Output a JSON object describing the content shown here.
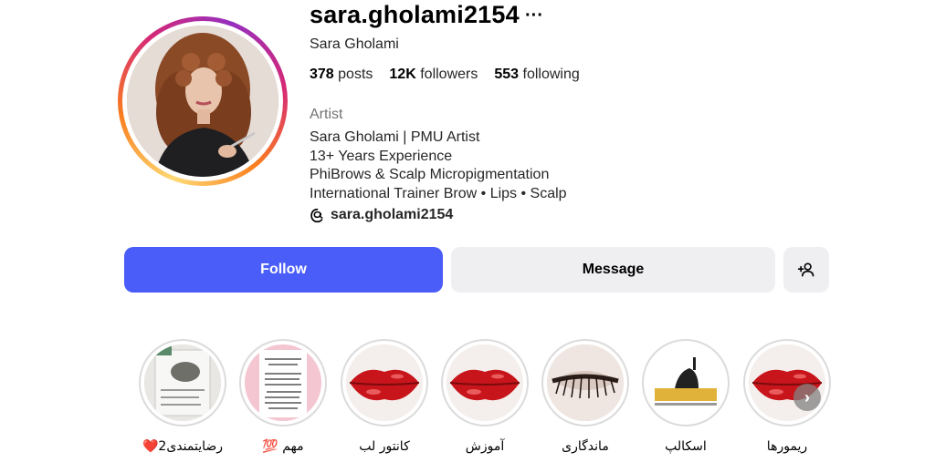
{
  "profile": {
    "username": "sara.gholami2154",
    "full_name": "Sara Gholami",
    "stats": {
      "posts_count": "378",
      "posts_label": "posts",
      "followers_count": "12K",
      "followers_label": "followers",
      "following_count": "553",
      "following_label": "following"
    },
    "category": "Artist",
    "bio_lines": [
      "Sara Gholami | PMU Artist",
      "13+ Years Experience",
      "PhiBrows & Scalp Micropigmentation",
      "International Trainer Brow • Lips • Scalp"
    ],
    "threads_handle": "sara.gholami2154"
  },
  "actions": {
    "follow_label": "Follow",
    "message_label": "Message",
    "add_user_icon": "add-user-icon",
    "more_icon": "more-horizontal-icon"
  },
  "colors": {
    "follow_button": "#4a5df9",
    "secondary_button": "#efeff2",
    "ring_gradient": [
      "#feda75",
      "#fa7e1e",
      "#d62976",
      "#962fbf"
    ]
  },
  "highlights": [
    {
      "label": "رضایتمندی2❤️",
      "thumb": "review-photo"
    },
    {
      "label": "مهم 💯",
      "thumb": "document"
    },
    {
      "label": "کانتور لب",
      "thumb": "lips"
    },
    {
      "label": "آموزش",
      "thumb": "lips"
    },
    {
      "label": "ماندگاری",
      "thumb": "eyelashes"
    },
    {
      "label": "اسکالپ",
      "thumb": "scalp-logo"
    },
    {
      "label": "ریمورها",
      "thumb": "lips"
    }
  ]
}
